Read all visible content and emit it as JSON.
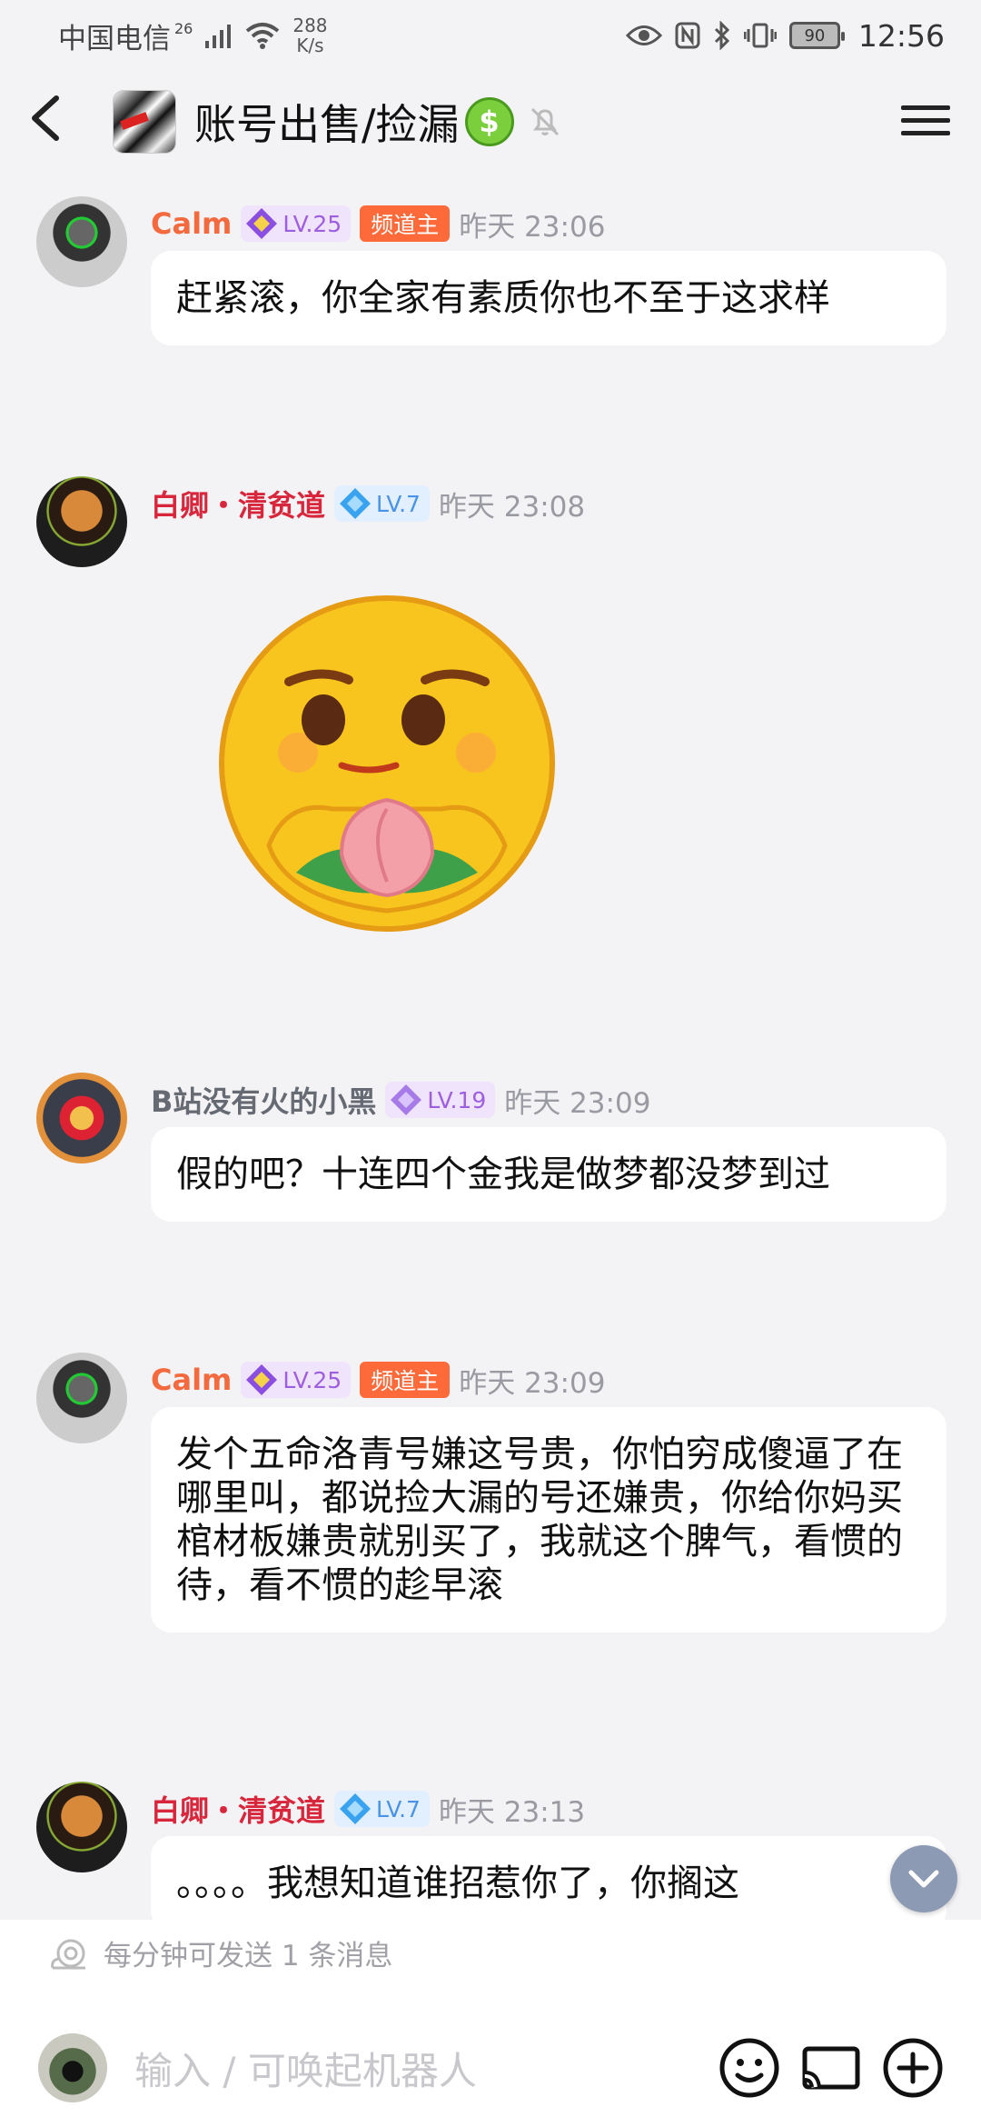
{
  "status_bar": {
    "carrier": "中国电信",
    "network": "26",
    "speed_value": "288",
    "speed_unit": "K/s",
    "battery": "90",
    "time": "12:56"
  },
  "header": {
    "title": "账号出售/捡漏"
  },
  "messages": [
    {
      "user": "Calm",
      "level": "LV.25",
      "badge": "频道主",
      "time": "昨天 23:06",
      "text": "赶紧滚，你全家有素质你也不至于这求样"
    },
    {
      "user": "白卿・清贫道",
      "level": "LV.7",
      "time": "昨天 23:08",
      "sticker": "pray-peach-emoji"
    },
    {
      "user": "B站没有火的小黑",
      "level": "LV.19",
      "time": "昨天 23:09",
      "text": "假的吧？十连四个金我是做梦都没梦到过"
    },
    {
      "user": "Calm",
      "level": "LV.25",
      "badge": "频道主",
      "time": "昨天 23:09",
      "text": "发个五命洛青号嫌这号贵，你怕穷成傻逼了在哪里叫，都说捡大漏的号还嫌贵，你给你妈买棺材板嫌贵就别买了，我就这个脾气，看惯的待，看不惯的趁早滚"
    },
    {
      "user": "白卿・清贫道",
      "level": "LV.7",
      "time": "昨天 23:13",
      "text": "。。。。我想知道谁招惹你了，你搁这"
    }
  ],
  "composer": {
    "rate_hint": "每分钟可发送 1 条消息",
    "placeholder": "输入 / 可唤起机器人"
  },
  "colors": {
    "owner_badge": "#ff6a3a",
    "name_orange": "#f26a3e",
    "name_red": "#d8273c",
    "level_purple": "#9e5ee0",
    "level_blue": "#4a93e6"
  }
}
